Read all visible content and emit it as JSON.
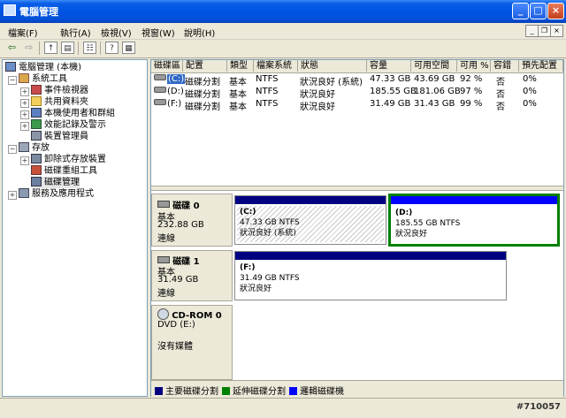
{
  "window": {
    "title": "電腦管理"
  },
  "menu": [
    "檔案(F)",
    "執行(A)",
    "檢視(V)",
    "視窗(W)",
    "說明(H)"
  ],
  "tree": {
    "root": "電腦管理 (本機)",
    "system_tools": "系統工具",
    "event_viewer": "事件檢視器",
    "shared_folders": "共用資料夾",
    "local_users": "本機使用者和群組",
    "perf_logs": "效能記錄及警示",
    "device_manager": "裝置管理員",
    "storage": "存放",
    "removable_storage": "卸除式存放裝置",
    "defrag": "磁碟重組工具",
    "disk_mgmt": "磁碟管理",
    "services": "服務及應用程式"
  },
  "columns": [
    "磁碟區",
    "配置",
    "類型",
    "檔案系統",
    "狀態",
    "容量",
    "可用空間",
    "可用 %",
    "容錯",
    "預先配置"
  ],
  "volumes": [
    [
      "(C:)",
      "磁碟分割",
      "基本",
      "NTFS",
      "狀況良好 (系統)",
      "47.33 GB",
      "43.69 GB",
      "92 %",
      "否",
      "0%"
    ],
    [
      "(D:)",
      "磁碟分割",
      "基本",
      "NTFS",
      "狀況良好",
      "185.55 GB",
      "181.06 GB",
      "97 %",
      "否",
      "0%"
    ],
    [
      "(F:)",
      "磁碟分割",
      "基本",
      "NTFS",
      "狀況良好",
      "31.49 GB",
      "31.43 GB",
      "99 %",
      "否",
      "0%"
    ]
  ],
  "disks": {
    "d0": {
      "name": "磁碟 0",
      "type": "基本",
      "size": "232.88 GB",
      "state": "連線",
      "p1": {
        "label": "(C:)",
        "size": "47.33 GB NTFS",
        "status": "狀況良好 (系統)"
      },
      "p2": {
        "label": "(D:)",
        "size": "185.55 GB NTFS",
        "status": "狀況良好"
      }
    },
    "d1": {
      "name": "磁碟 1",
      "type": "基本",
      "size": "31.49 GB",
      "state": "連線",
      "p1": {
        "label": "(F:)",
        "size": "31.49 GB NTFS",
        "status": "狀況良好"
      }
    },
    "cd": {
      "name": "CD-ROM 0",
      "type": "DVD (E:)",
      "media": "沒有媒體"
    }
  },
  "legend": [
    "主要磁碟分割",
    "延伸磁碟分割",
    "邏輯磁碟機"
  ],
  "colors": {
    "primary": "#000080",
    "extended": "#008000",
    "logical": "#0000ff",
    "titlebar": "#0054e3"
  },
  "watermark": "#710057"
}
